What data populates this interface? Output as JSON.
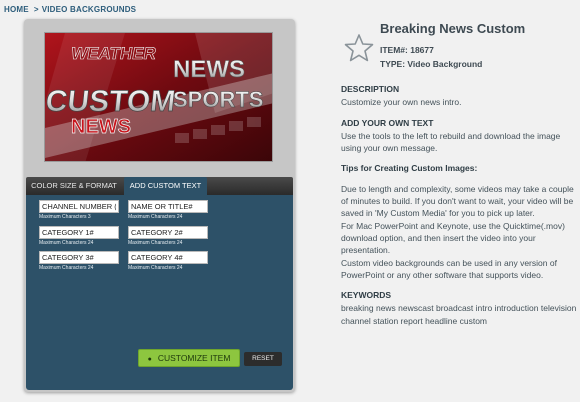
{
  "breadcrumb": {
    "home": "HOME",
    "separator": ">",
    "current": "VIDEO BACKGROUNDS"
  },
  "preview": {
    "words": {
      "weather": "WEATHER",
      "custom": "CUSTOM",
      "news_top": "NEWS",
      "sports": "SPORTS",
      "news_bottom": "NEWS"
    }
  },
  "tabs": {
    "color_size_format": "COLOR SIZE & FORMAT",
    "add_custom_text": "ADD CUSTOM TEXT",
    "active": "add_custom_text"
  },
  "form": {
    "fields": [
      {
        "value": "CHANNEL NUMBER (C",
        "hint": "Maximum Characters 3"
      },
      {
        "value": "NAME OR TITLE#",
        "hint": "Maximum Characters 24"
      },
      {
        "value": "CATEGORY 1#",
        "hint": "Maximum Characters 24"
      },
      {
        "value": "CATEGORY 2#",
        "hint": "Maximum Characters 24"
      },
      {
        "value": "CATEGORY 3#",
        "hint": "Maximum Characters 24"
      },
      {
        "value": "CATEGORY 4#",
        "hint": "Maximum Characters 24"
      }
    ],
    "customize_label": "CUSTOMIZE ITEM",
    "reset_label": "RESET"
  },
  "product": {
    "title": "Breaking News Custom",
    "item_id": "ITEM#: 18677",
    "type": "TYPE: Video Background"
  },
  "description": {
    "heading": "DESCRIPTION",
    "text": "Customize your own news intro."
  },
  "add_text": {
    "heading": "ADD YOUR OWN TEXT",
    "text": "Use the tools to the left to rebuild and download the image using your own message."
  },
  "tips": {
    "heading": "Tips for Creating Custom Images:",
    "p1": "Due to length and complexity, some videos may take a couple of minutes to build. If you don't want to wait, your video will be saved in 'My Custom Media' for you to pick up later.",
    "p2": "For Mac PowerPoint and Keynote, use the Quicktime(.mov) download option, and then insert the video into your presentation.",
    "p3": "Custom video backgrounds can be used in any version of PowerPoint or any other software that supports video."
  },
  "keywords": {
    "heading": "KEYWORDS",
    "text": "breaking news newscast broadcast intro introduction television channel station report headline custom"
  },
  "colors": {
    "accent_green": "#8dc63f",
    "panel_blue": "#2d5168",
    "link_blue": "#2d5d7b"
  },
  "icons": {
    "favorite": "star-icon",
    "customize": "camera-icon"
  }
}
